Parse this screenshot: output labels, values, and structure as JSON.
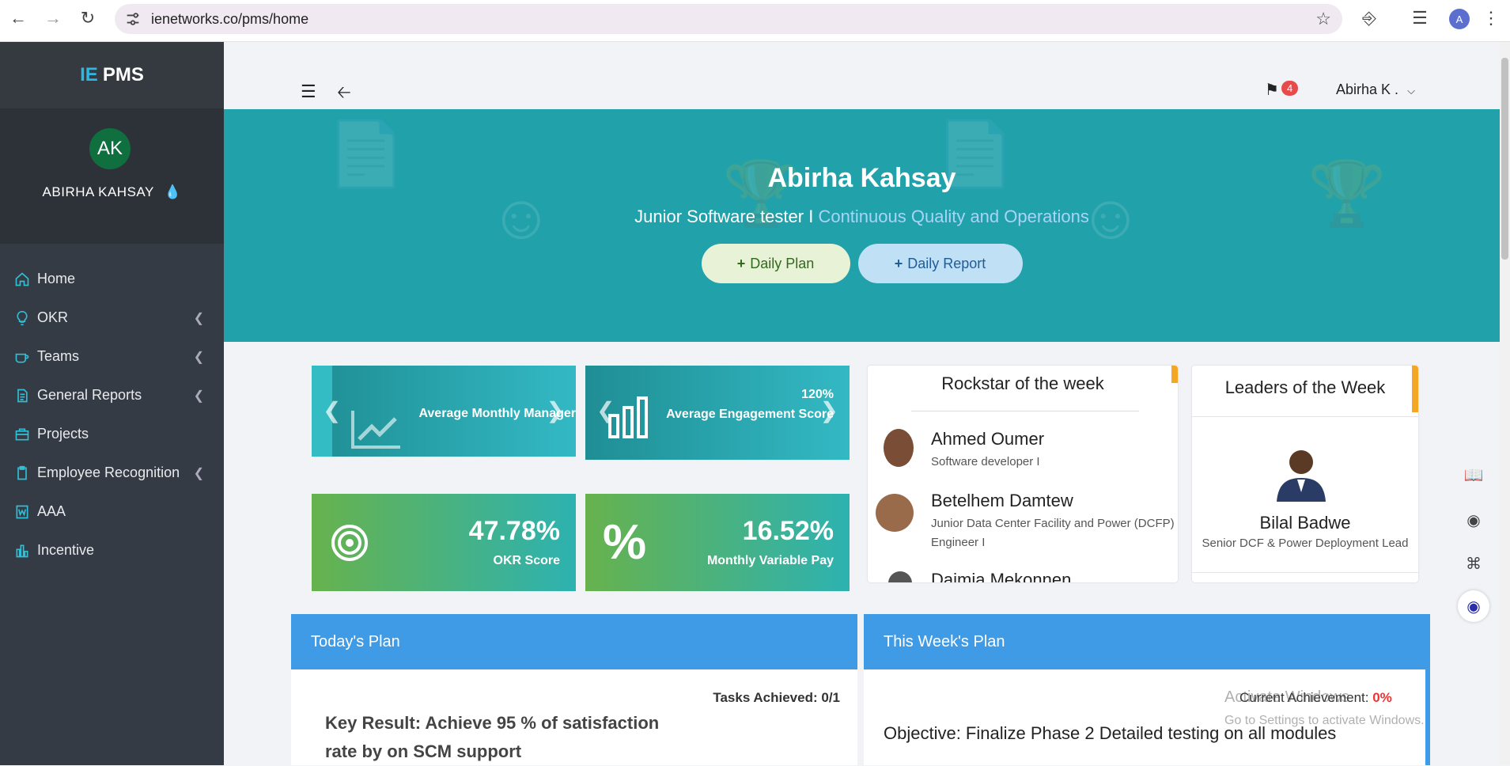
{
  "browser": {
    "url": "ienetworks.co/pms/home",
    "profile_initial": "A"
  },
  "sidebar": {
    "brand": "PMS",
    "brand_logo": "IE",
    "user_initials": "AK",
    "user_name": "ABIRHA KAHSAY",
    "items": [
      {
        "label": "Home",
        "icon": "home-icon",
        "has_caret": false
      },
      {
        "label": "OKR",
        "icon": "lightbulb-icon",
        "has_caret": true
      },
      {
        "label": "Teams",
        "icon": "mug-icon",
        "has_caret": true
      },
      {
        "label": "General Reports",
        "icon": "report-icon",
        "has_caret": true
      },
      {
        "label": "Projects",
        "icon": "briefcase-icon",
        "has_caret": false
      },
      {
        "label": "Employee Recognition",
        "icon": "clipboard-icon",
        "has_caret": true
      },
      {
        "label": "AAA",
        "icon": "word-icon",
        "has_caret": false
      },
      {
        "label": "Incentive",
        "icon": "chart-icon",
        "has_caret": false
      }
    ]
  },
  "topbar": {
    "notification_count": "4",
    "user_short": "Abirha K ."
  },
  "hero": {
    "name": "Abirha Kahsay",
    "title": "Junior Software tester I",
    "separator": " I ",
    "department": "Continuous Quality and Operations",
    "daily_plan": "Daily Plan",
    "daily_report": "Daily Report"
  },
  "cards": {
    "avg_monthly": "Average Monthly Manager",
    "engagement_value": "120%",
    "engagement_label": "Average Engagement Score",
    "okr_value": "47.78%",
    "okr_label": "OKR Score",
    "variable_value": "16.52%",
    "variable_label": "Monthly Variable Pay"
  },
  "rockstar": {
    "title": "Rockstar of the week",
    "people": [
      {
        "name": "Ahmed Oumer",
        "role": "Software developer I"
      },
      {
        "name": "Betelhem Damtew",
        "role": "Junior Data Center Facility and Power (DCFP) Engineer I"
      },
      {
        "name": "Daimia Mekonnen",
        "role": ""
      }
    ]
  },
  "leaders": {
    "title": "Leaders of the Week",
    "name": "Bilal Badwe",
    "role": "Senior DCF & Power Deployment Lead"
  },
  "today_plan": {
    "header": "Today's Plan",
    "tasks": "Tasks Achieved: 0/1",
    "key_result": "Key Result: Achieve 95 % of satisfaction rate by on SCM support"
  },
  "week_plan": {
    "header": "This Week's Plan",
    "achievement_label": "Current Achievement:",
    "achievement_value": "0%",
    "objective": "Objective: Finalize Phase 2 Detailed testing on all modules"
  },
  "watermark": {
    "line1": "Activate Windows",
    "line2": "Go to Settings to activate Windows."
  }
}
